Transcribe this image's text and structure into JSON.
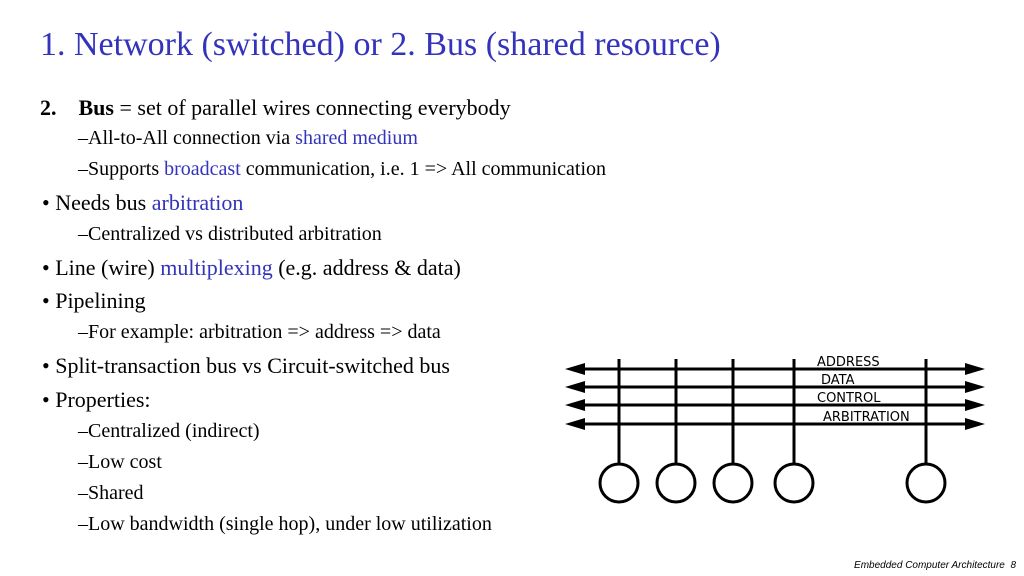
{
  "slide": {
    "title": "1. Network (switched) or 2. Bus (shared resource)",
    "heading": {
      "number": "2.",
      "term": "Bus",
      "rest": " = set of parallel wires connecting everybody"
    },
    "items": [
      {
        "level": 2,
        "marker": "–",
        "parts": [
          {
            "text": "All-to-All connection via "
          },
          {
            "text": "shared medium",
            "highlight": true
          }
        ]
      },
      {
        "level": 2,
        "marker": "–",
        "parts": [
          {
            "text": "Supports "
          },
          {
            "text": "broadcast",
            "highlight": true
          },
          {
            "text": " communication, i.e. 1 => All communication"
          }
        ]
      },
      {
        "level": 1,
        "marker": "•",
        "parts": [
          {
            "text": "Needs bus "
          },
          {
            "text": "arbitration",
            "highlight": true
          }
        ]
      },
      {
        "level": 2,
        "marker": "–",
        "parts": [
          {
            "text": "Centralized vs distributed arbitration"
          }
        ]
      },
      {
        "level": 1,
        "marker": "•",
        "parts": [
          {
            "text": "Line (wire) "
          },
          {
            "text": "multiplexing",
            "highlight": true
          },
          {
            "text": " (e.g. address & data)"
          }
        ]
      },
      {
        "level": 1,
        "marker": "•",
        "parts": [
          {
            "text": "Pipelining"
          }
        ]
      },
      {
        "level": 2,
        "marker": "–",
        "parts": [
          {
            "text": "For example: arbitration => address => data"
          }
        ]
      },
      {
        "level": 1,
        "marker": "•",
        "parts": [
          {
            "text": "Split-transaction bus vs Circuit-switched bus"
          }
        ]
      },
      {
        "level": 1,
        "marker": "•",
        "parts": [
          {
            "text": "Properties:"
          }
        ]
      },
      {
        "level": 2,
        "marker": "–",
        "parts": [
          {
            "text": "Centralized (indirect)"
          }
        ]
      },
      {
        "level": 2,
        "marker": "–",
        "parts": [
          {
            "text": "Low cost"
          }
        ]
      },
      {
        "level": 2,
        "marker": "–",
        "parts": [
          {
            "text": "Shared"
          }
        ]
      },
      {
        "level": 2,
        "marker": "–",
        "parts": [
          {
            "text": "Low bandwidth (single hop), under low utilization"
          }
        ]
      }
    ],
    "diagram": {
      "bus_lines": [
        "ADDRESS",
        "DATA",
        "CONTROL",
        "ARBITRATION"
      ],
      "node_count": 5
    },
    "footer": {
      "course": "Embedded Computer Architecture",
      "page": "8"
    },
    "colors": {
      "accent": "#3333bb",
      "text": "#000000"
    }
  }
}
